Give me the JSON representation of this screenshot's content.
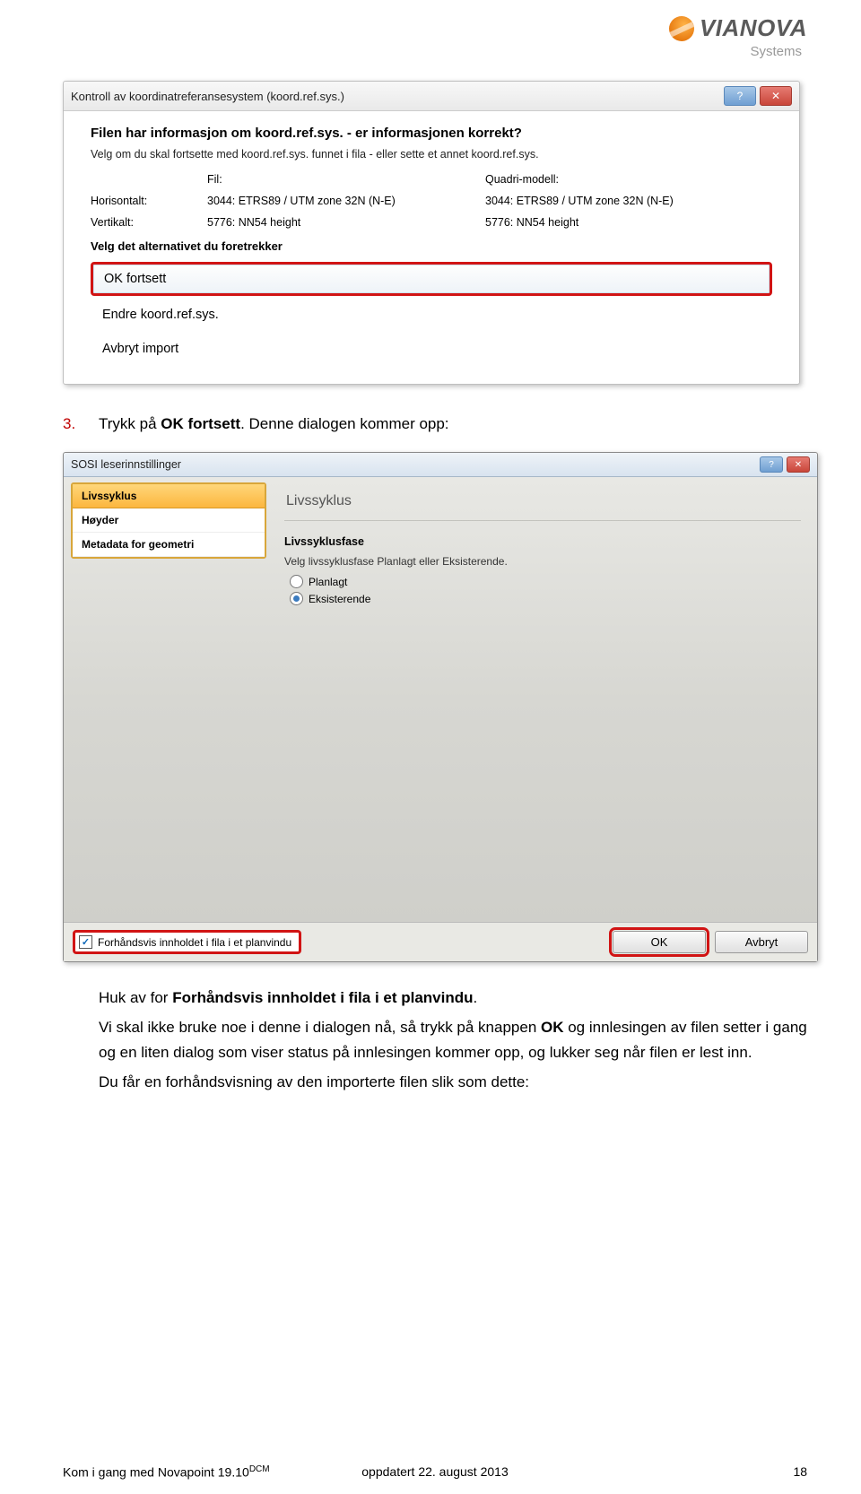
{
  "logo": {
    "brand": "VIANOVA",
    "sub": "Systems"
  },
  "dialog1": {
    "title": "Kontroll av koordinatreferansesystem (koord.ref.sys.)",
    "heading": "Filen har informasjon om koord.ref.sys. - er informasjonen korrekt?",
    "sub": "Velg om du skal fortsette med koord.ref.sys. funnet i fila - eller sette et annet koord.ref.sys.",
    "col_file": "Fil:",
    "col_model": "Quadri-modell:",
    "row_h_label": "Horisontalt:",
    "row_h_file": "3044: ETRS89 / UTM zone 32N (N-E)",
    "row_h_model": "3044: ETRS89 / UTM zone 32N (N-E)",
    "row_v_label": "Vertikalt:",
    "row_v_file": "5776: NN54 height",
    "row_v_model": "5776: NN54 height",
    "choose": "Velg det alternativet du foretrekker",
    "opt_ok": "OK fortsett",
    "opt_change": "Endre koord.ref.sys.",
    "opt_abort": "Avbryt import"
  },
  "step": {
    "num": "3.",
    "pre": "Trykk på ",
    "bold": "OK fortsett",
    "post": ". Denne dialogen kommer opp:"
  },
  "dialog2": {
    "title": "SOSI leserinnstillinger",
    "left": {
      "i0": "Livssyklus",
      "i1": "Høyder",
      "i2": "Metadata for geometri"
    },
    "right_h": "Livssyklus",
    "sec": "Livssyklusfase",
    "desc": "Velg livssyklusfase Planlagt eller Eksisterende.",
    "r0": "Planlagt",
    "r1": "Eksisterende",
    "preview": "Forhåndsvis innholdet i fila i et planvindu",
    "ok": "OK",
    "cancel": "Avbryt"
  },
  "para1_pre": "Huk av for ",
  "para1_bold": "Forhåndsvis innholdet i fila i et planvindu",
  "para1_post": ".",
  "para2_a": "Vi skal ikke bruke noe i denne i dialogen nå, så trykk på knappen ",
  "para2_bold": "OK",
  "para2_b": " og innlesingen av filen setter i gang og en liten dialog som viser status på innlesingen kommer opp, og lukker seg når filen er lest inn.",
  "para3": "Du får en forhåndsvisning av den importerte filen slik som dette:",
  "footer": {
    "left_a": "Kom i gang med Novapoint 19.10",
    "left_sup": "DCM",
    "mid": "oppdatert 22. august 2013",
    "right": "18"
  }
}
